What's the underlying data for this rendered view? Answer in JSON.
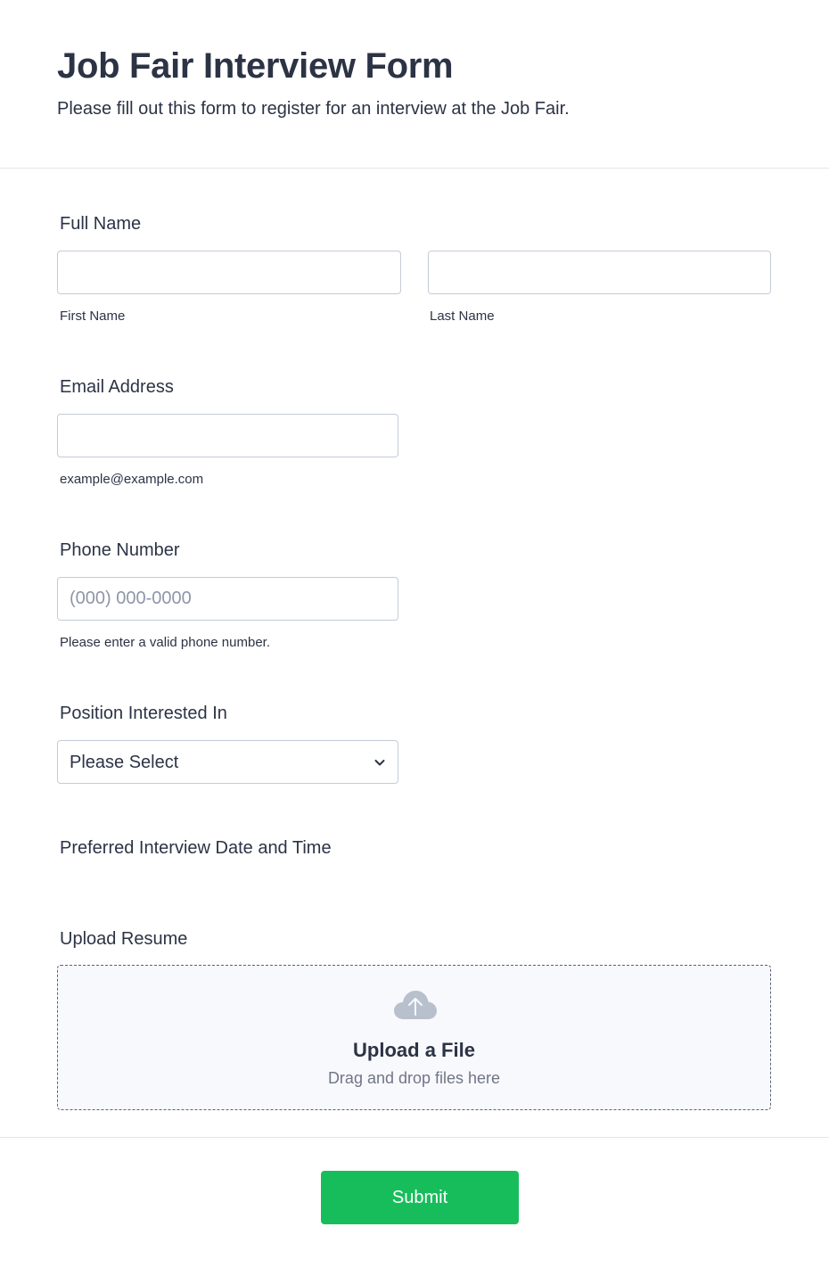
{
  "header": {
    "title": "Job Fair Interview Form",
    "subtitle": "Please fill out this form to register for an interview at the Job Fair."
  },
  "full_name": {
    "label": "Full Name",
    "first_value": "",
    "last_value": "",
    "first_sublabel": "First Name",
    "last_sublabel": "Last Name"
  },
  "email": {
    "label": "Email Address",
    "value": "",
    "sublabel": "example@example.com"
  },
  "phone": {
    "label": "Phone Number",
    "value": "",
    "placeholder": "(000) 000-0000",
    "sublabel": "Please enter a valid phone number."
  },
  "position": {
    "label": "Position Interested In",
    "selected": "Please Select",
    "icon": "chevron-down-icon"
  },
  "interview_datetime": {
    "label": "Preferred Interview Date and Time"
  },
  "resume": {
    "label": "Upload Resume",
    "upload_title": "Upload a File",
    "upload_sub": "Drag and drop files here",
    "icon": "cloud-upload-icon"
  },
  "submit": {
    "label": "Submit",
    "color": "#18bd5b"
  },
  "colors": {
    "text": "#2c3345",
    "border": "#c3cad8",
    "muted": "#6f7687",
    "upload_bg": "#f8f9fc"
  }
}
